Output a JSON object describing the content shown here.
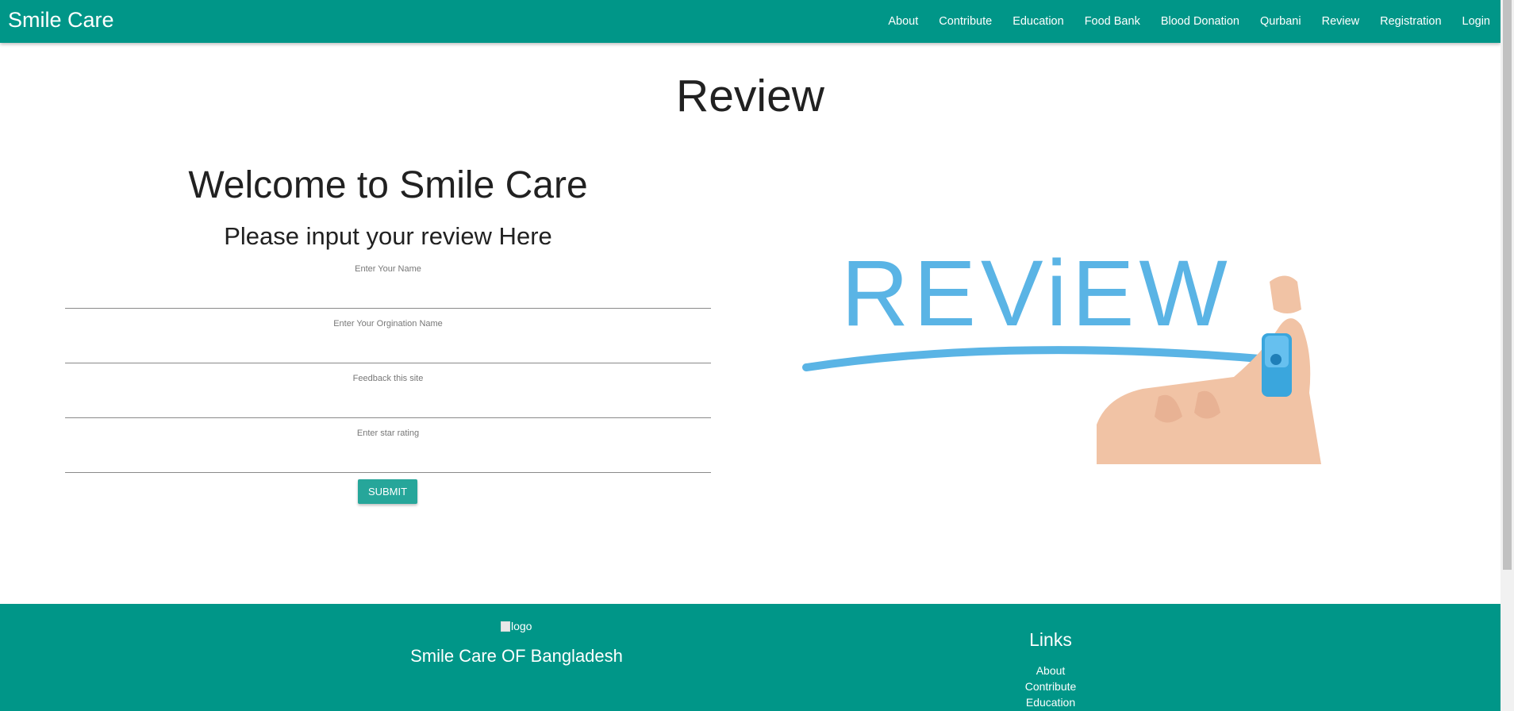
{
  "navbar": {
    "brand": "Smile Care",
    "links": [
      "About",
      "Contribute",
      "Education",
      "Food Bank",
      "Blood Donation",
      "Qurbani",
      "Review",
      "Registration",
      "Login"
    ]
  },
  "main": {
    "page_title": "Review",
    "welcome": "Welcome to Smile Care",
    "subtitle": "Please input your review Here",
    "fields": [
      {
        "label": "Enter Your Name",
        "value": ""
      },
      {
        "label": "Enter Your Orgination Name",
        "value": ""
      },
      {
        "label": "Feedback this site",
        "value": ""
      },
      {
        "label": "Enter star rating",
        "value": ""
      }
    ],
    "submit_label": "SUBMIT",
    "image_text": "REViEW"
  },
  "footer": {
    "logo_alt": "logo",
    "org_name": "Smile Care OF Bangladesh",
    "links_title": "Links",
    "links": [
      "About",
      "Contribute",
      "Education"
    ]
  },
  "colors": {
    "primary": "#009688",
    "button": "#26a69a",
    "illustration_blue": "#5ab4e5"
  }
}
